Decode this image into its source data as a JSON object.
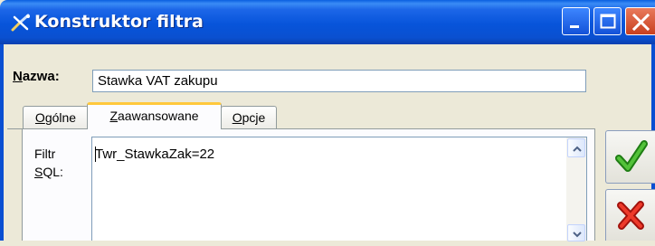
{
  "window": {
    "title": "Konstruktor filtra",
    "icon": "filter-builder-icon",
    "controls": [
      "minimize-icon",
      "maximize-icon",
      "close-icon"
    ]
  },
  "name_field": {
    "label_underlined": "N",
    "label_rest": "azwa:",
    "value": "Stawka VAT zakupu"
  },
  "tabs": [
    {
      "underlined": "O",
      "rest": "gólne",
      "active": false
    },
    {
      "underlined": "Z",
      "rest": "aawansowane",
      "active": true
    },
    {
      "underlined": "O",
      "rest": "pcje",
      "active": false
    }
  ],
  "sql": {
    "label_line1": "Filtr",
    "label_line2_underlined": "S",
    "label_line2_rest": "QL:",
    "value": "Twr_StawkaZak=22"
  },
  "actions": {
    "ok_icon": "checkmark-icon",
    "cancel_icon": "cross-icon"
  },
  "colors": {
    "titlebar": "#0a54da",
    "close_button": "#d6532f",
    "active_tab_accent": "#ffc83c",
    "ok_green": "#2a9a1c",
    "cancel_red": "#e0241b"
  }
}
